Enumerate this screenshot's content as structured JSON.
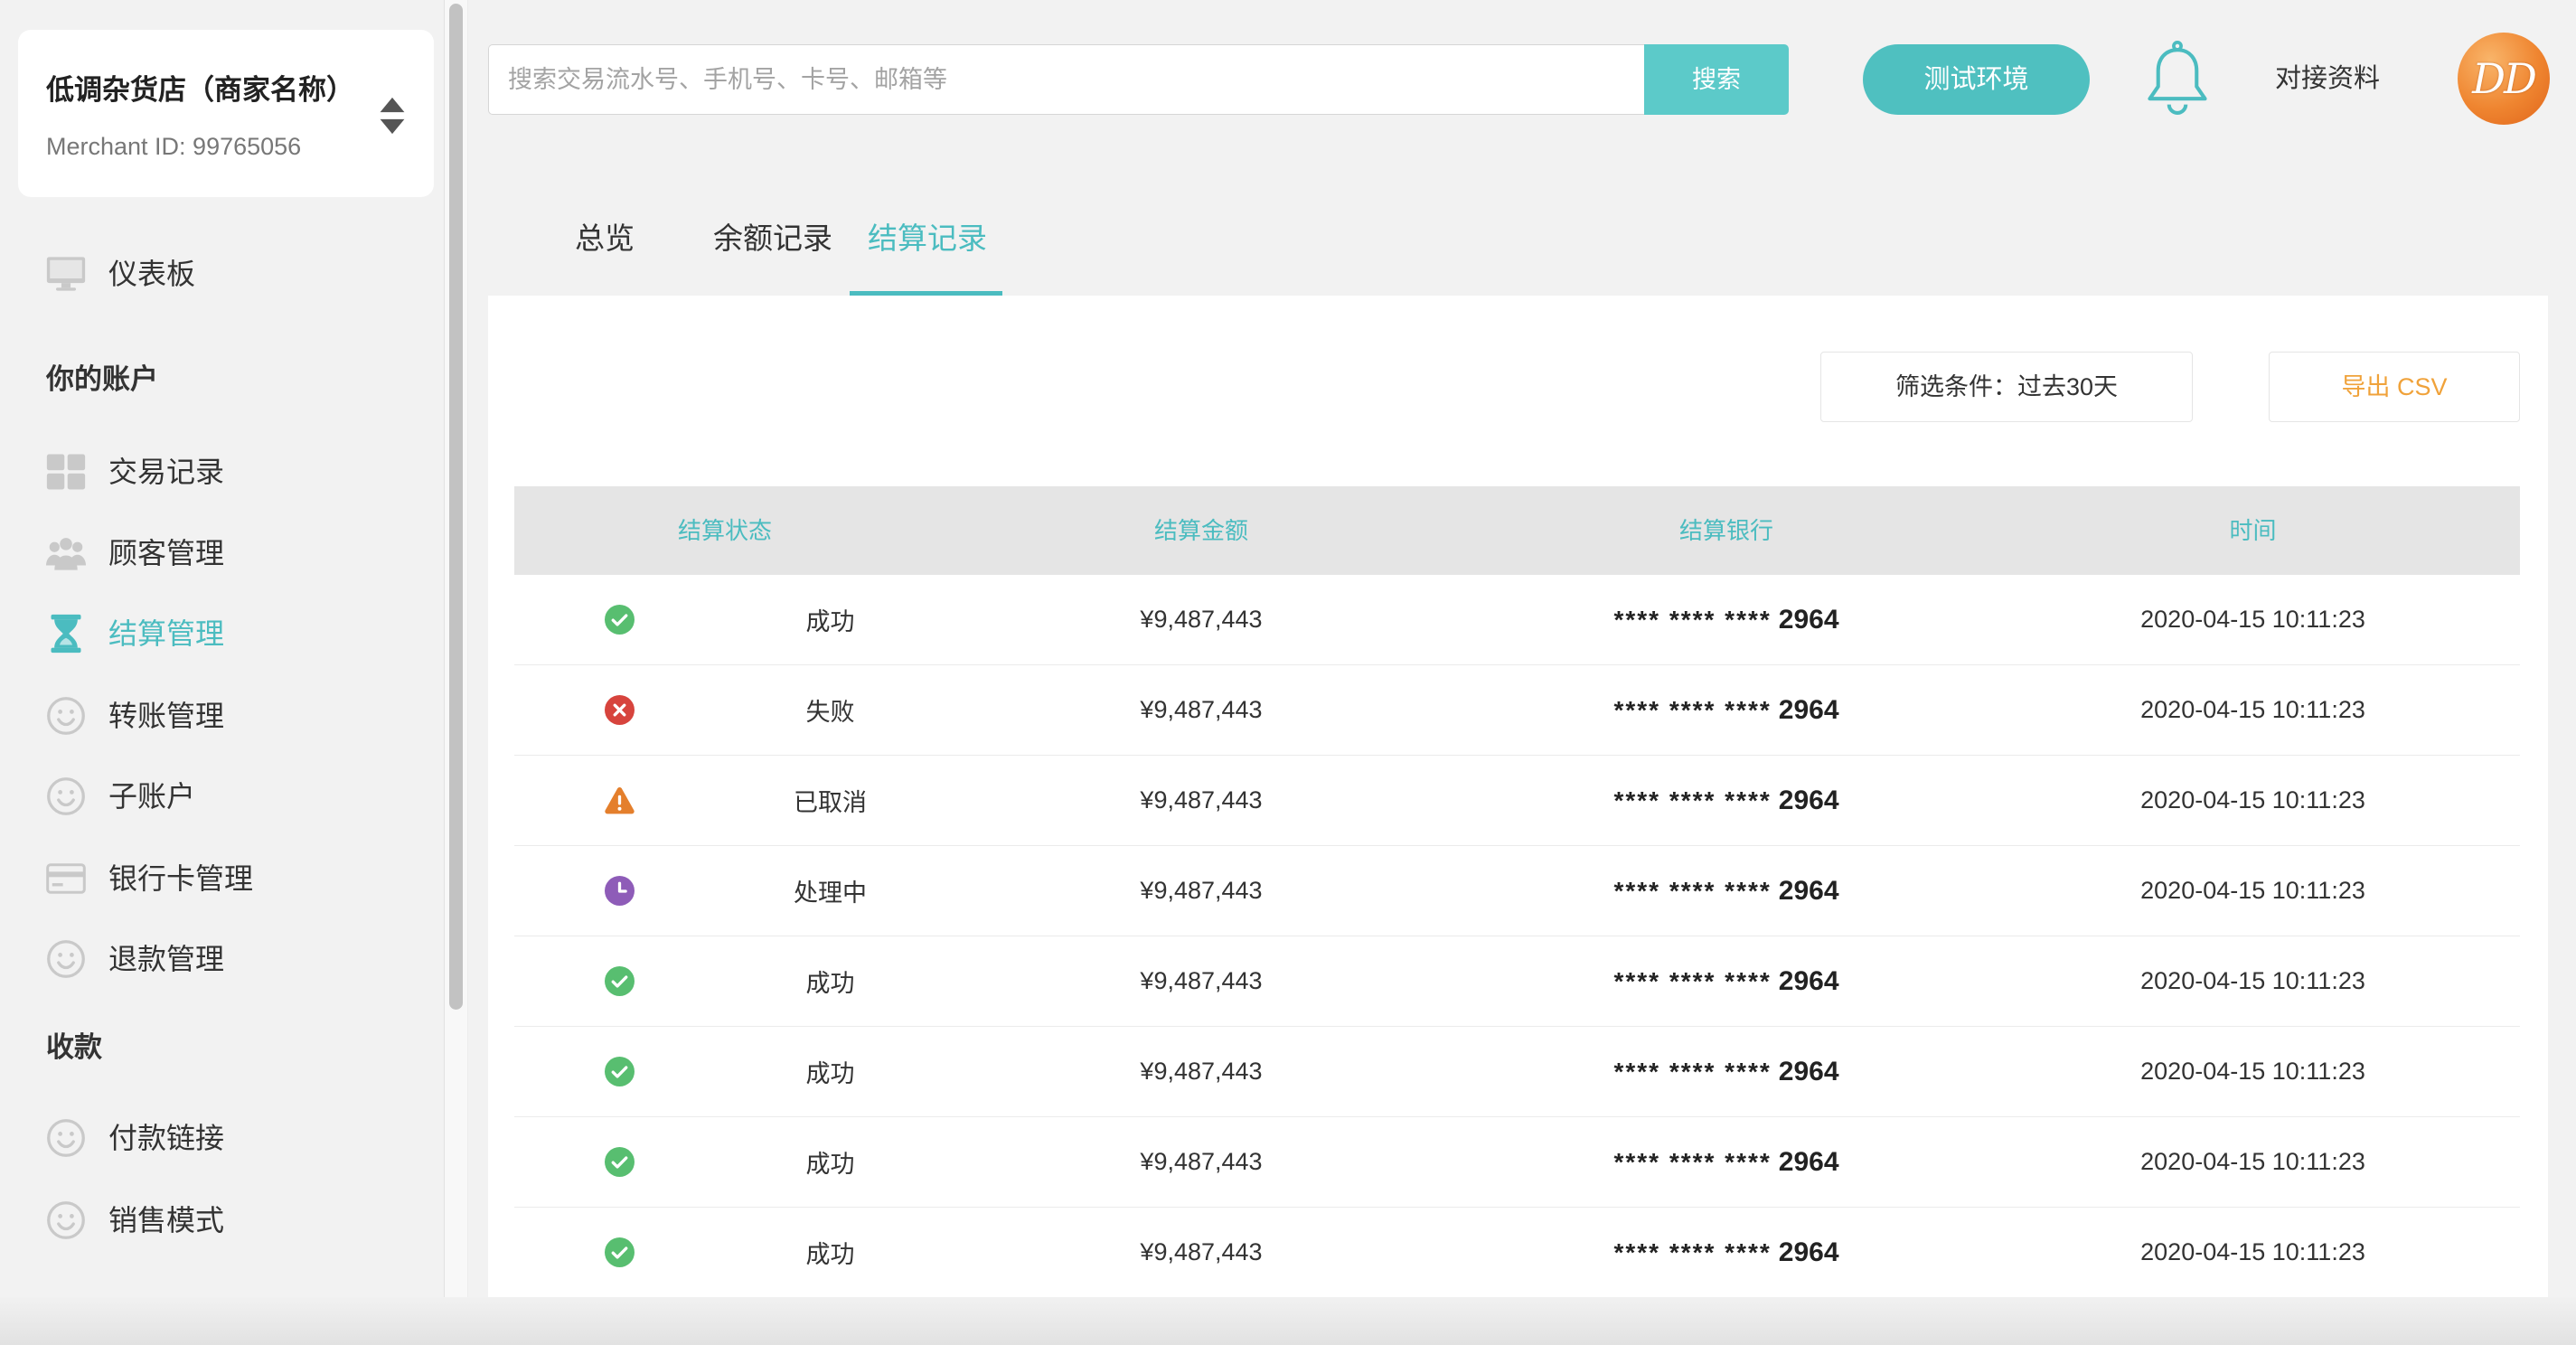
{
  "colors": {
    "accent": "#4bbcc0",
    "search_button": "#5ccac9",
    "env_button": "#4fc0c0",
    "success": "#58be70",
    "error": "#d7443d",
    "warning": "#e47f2c",
    "processing": "#8e5cb8",
    "export_text": "#f0a23a",
    "sidebar_icon": "#c9c9c9"
  },
  "merchant": {
    "name": "低调杂货店（商家名称）",
    "id_label": "Merchant ID: 99765056",
    "switch_icon": "sort-arrows-icon"
  },
  "sidebar": {
    "dashboard": {
      "label": "仪表板",
      "icon": "monitor-icon"
    },
    "account_title": "你的账户",
    "account_items": [
      {
        "label": "交易记录",
        "icon": "grid-icon"
      },
      {
        "label": "顾客管理",
        "icon": "users-icon"
      },
      {
        "label": "结算管理",
        "icon": "hourglass-icon",
        "active": true
      },
      {
        "label": "转账管理",
        "icon": "smiley-icon"
      },
      {
        "label": "子账户",
        "icon": "smiley-icon"
      },
      {
        "label": "银行卡管理",
        "icon": "credit-card-icon"
      },
      {
        "label": "退款管理",
        "icon": "smiley-icon"
      }
    ],
    "payments_title": "收款",
    "payments_items": [
      {
        "label": "付款链接",
        "icon": "smiley-icon"
      },
      {
        "label": "销售模式",
        "icon": "smiley-icon"
      }
    ]
  },
  "header": {
    "search_placeholder": "搜索交易流水号、手机号、卡号、邮箱等",
    "search_value": "",
    "search_button": "搜索",
    "env_button": "测试环境",
    "notification_icon": "bell-icon",
    "docs_link": "对接资料",
    "avatar_text": "DD"
  },
  "tabs": [
    {
      "label": "总览"
    },
    {
      "label": "余额记录"
    },
    {
      "label": "结算记录",
      "active": true
    }
  ],
  "toolbar": {
    "filter": "筛选条件：过去30天",
    "export": "导出 CSV"
  },
  "table": {
    "columns": [
      "结算状态",
      "结算金额",
      "结算银行",
      "时间"
    ],
    "rows": [
      {
        "icon": "check-circle-icon",
        "status": "成功",
        "amount": "¥9,487,443",
        "bank_mask": "**** **** ****",
        "bank_last4": "2964",
        "time": "2020-04-15 10:11:23"
      },
      {
        "icon": "error-circle-icon",
        "status": "失败",
        "amount": "¥9,487,443",
        "bank_mask": "**** **** ****",
        "bank_last4": "2964",
        "time": "2020-04-15 10:11:23"
      },
      {
        "icon": "warning-triangle-icon",
        "status": "已取消",
        "amount": "¥9,487,443",
        "bank_mask": "**** **** ****",
        "bank_last4": "2964",
        "time": "2020-04-15 10:11:23"
      },
      {
        "icon": "clock-circle-icon",
        "status": "处理中",
        "amount": "¥9,487,443",
        "bank_mask": "**** **** ****",
        "bank_last4": "2964",
        "time": "2020-04-15 10:11:23"
      },
      {
        "icon": "check-circle-icon",
        "status": "成功",
        "amount": "¥9,487,443",
        "bank_mask": "**** **** ****",
        "bank_last4": "2964",
        "time": "2020-04-15 10:11:23"
      },
      {
        "icon": "check-circle-icon",
        "status": "成功",
        "amount": "¥9,487,443",
        "bank_mask": "**** **** ****",
        "bank_last4": "2964",
        "time": "2020-04-15 10:11:23"
      },
      {
        "icon": "check-circle-icon",
        "status": "成功",
        "amount": "¥9,487,443",
        "bank_mask": "**** **** ****",
        "bank_last4": "2964",
        "time": "2020-04-15 10:11:23"
      },
      {
        "icon": "check-circle-icon",
        "status": "成功",
        "amount": "¥9,487,443",
        "bank_mask": "**** **** ****",
        "bank_last4": "2964",
        "time": "2020-04-15 10:11:23"
      }
    ]
  }
}
